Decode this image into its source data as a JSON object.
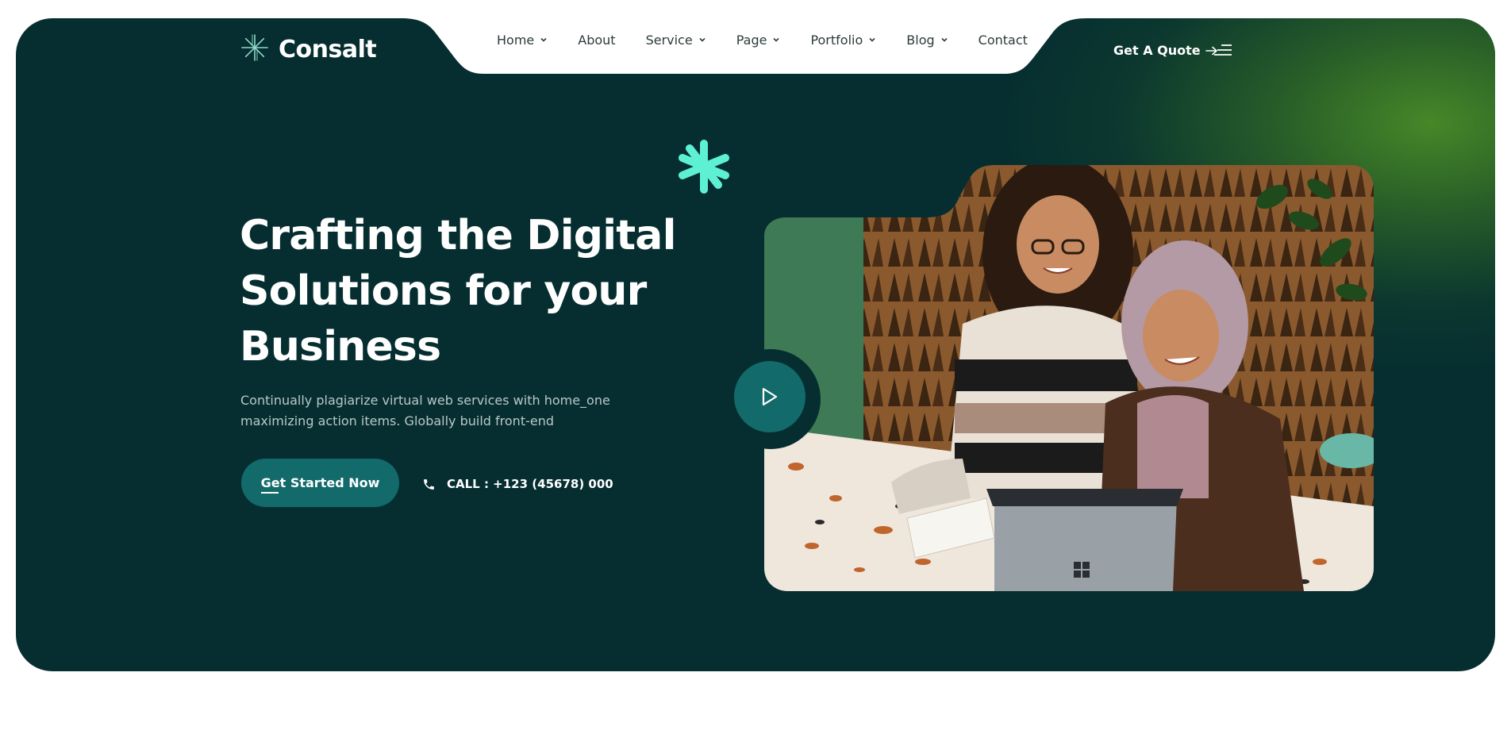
{
  "brand": {
    "name": "Consalt"
  },
  "nav": {
    "items": [
      {
        "label": "Home",
        "dropdown": true
      },
      {
        "label": "About",
        "dropdown": false
      },
      {
        "label": "Service",
        "dropdown": true
      },
      {
        "label": "Page",
        "dropdown": true
      },
      {
        "label": "Portfolio",
        "dropdown": true
      },
      {
        "label": "Blog",
        "dropdown": true
      },
      {
        "label": "Contact",
        "dropdown": false
      }
    ]
  },
  "header": {
    "quote_label": "Get A Quote"
  },
  "hero": {
    "title": "Crafting the Digital Solutions for your Business",
    "description": "Continually plagiarize virtual web services with home_one maximizing action items. Globally build front-end",
    "cta_label": "Get Started Now",
    "call_label": "CALL : +123 (45678) 000"
  },
  "icons": {
    "logo": "asterisk-logo-icon",
    "dropdown": "chevron-down-icon",
    "quote": "arrow-right-icon",
    "menu": "menu-lines-icon",
    "phone": "phone-icon",
    "decor": "asterisk-decor-icon",
    "play": "play-icon"
  },
  "colors": {
    "hero_bg": "#062e30",
    "accent": "#126a6a",
    "decor_star": "#5ef0d2",
    "glow": "#4a8c28",
    "nav_text": "#2c3a3b"
  }
}
